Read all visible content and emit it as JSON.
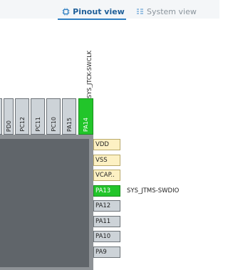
{
  "tabs": {
    "pinout_label": "Pinout view",
    "system_label": "System view"
  },
  "top_pins": [
    {
      "label": "",
      "color": "#cdd3d8"
    },
    {
      "label": "PD0",
      "color": "#cdd3d8"
    },
    {
      "label": "PC12",
      "color": "#cdd3d8"
    },
    {
      "label": "PC11",
      "color": "#cdd3d8"
    },
    {
      "label": "PC10",
      "color": "#cdd3d8"
    },
    {
      "label": "PA15",
      "color": "#cdd3d8"
    },
    {
      "label": "PA14",
      "color": "#22c52a"
    }
  ],
  "top_signal": "SYS_JTCK-SWCLK",
  "right_pins": [
    {
      "label": "VDD",
      "type": "power"
    },
    {
      "label": "VSS",
      "type": "power"
    },
    {
      "label": "VCAP..",
      "type": "power"
    },
    {
      "label": "PA13",
      "type": "assigned"
    },
    {
      "label": "PA12",
      "type": "io"
    },
    {
      "label": "PA11",
      "type": "io"
    },
    {
      "label": "PA10",
      "type": "io"
    },
    {
      "label": "PA9",
      "type": "io"
    }
  ],
  "right_signal": "SYS_JTMS-SWDIO"
}
